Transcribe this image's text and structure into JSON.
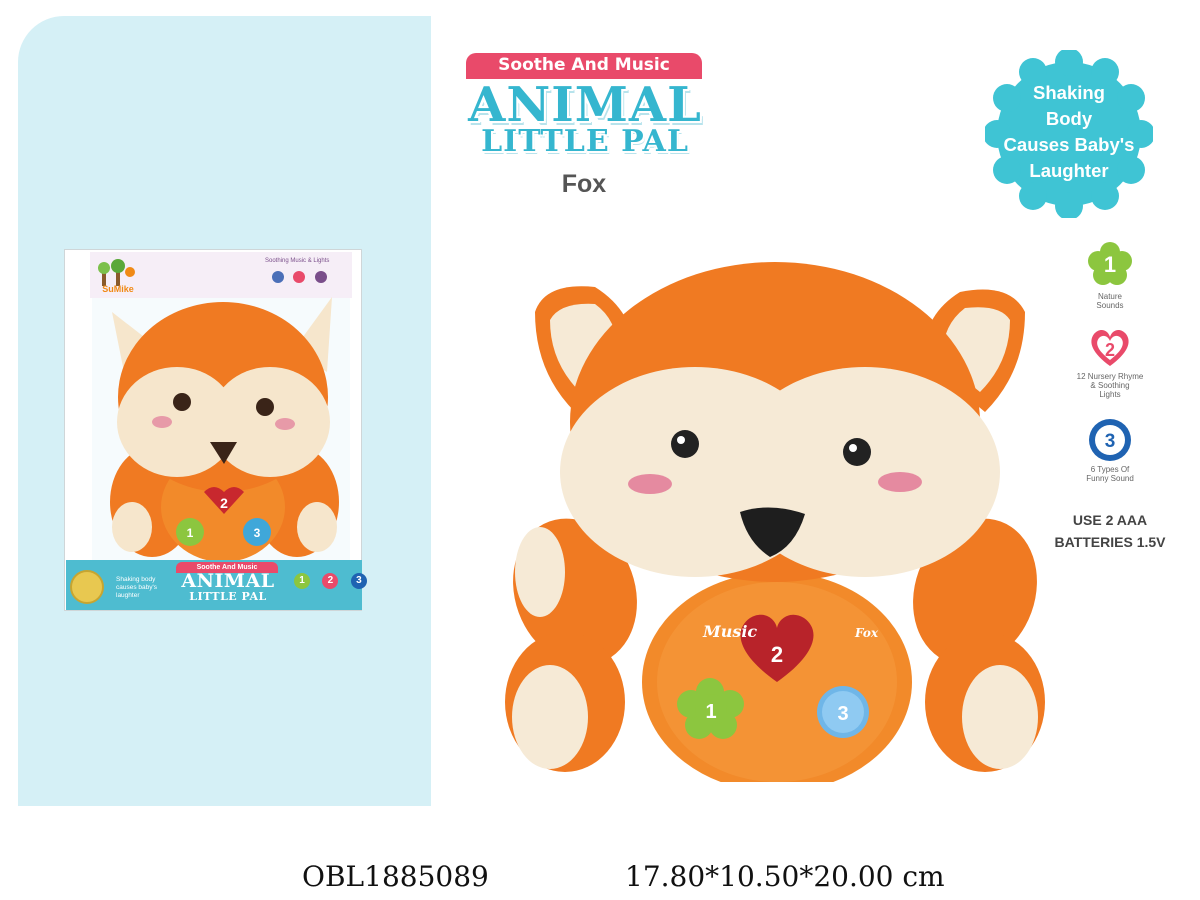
{
  "header": {
    "ribbon": "Soothe And Music",
    "title": "ANIMAL",
    "subtitle": "LITTLE PAL",
    "product": "Fox"
  },
  "badge": {
    "lines": [
      "Shaking",
      "Body",
      "Causes Baby's",
      "Laughter"
    ],
    "color": "#3fc4d4"
  },
  "features": [
    {
      "number": "1",
      "label_lines": [
        "Nature",
        "Sounds"
      ],
      "color": "#8cc63f",
      "shape": "flower-icon"
    },
    {
      "number": "2",
      "label_lines": [
        "12 Nursery Rhyme",
        "& Soothing",
        "Lights"
      ],
      "color": "#e94a6a",
      "shape": "heart-icon"
    },
    {
      "number": "3",
      "label_lines": [
        "6 Types Of",
        "Funny Sound"
      ],
      "color": "#1f63b2",
      "shape": "circle-icon"
    }
  ],
  "batteries": [
    "USE 2 AAA",
    "BATTERIES 1.5V"
  ],
  "box": {
    "brand": "SuMike",
    "header_text": "Soothing Music & Lights",
    "ribbon": "Soothe And Music",
    "title": "ANIMAL",
    "subtitle": "LITTLE PAL",
    "slogan": "Shaking body causes baby's laughter"
  },
  "toy": {
    "music_label": "Music",
    "fox_label": "Fox",
    "buttons": [
      "1",
      "2",
      "3"
    ]
  },
  "footer": {
    "item_code": "OBL1885089",
    "dimensions": "17.80*10.50*20.00 cm"
  }
}
